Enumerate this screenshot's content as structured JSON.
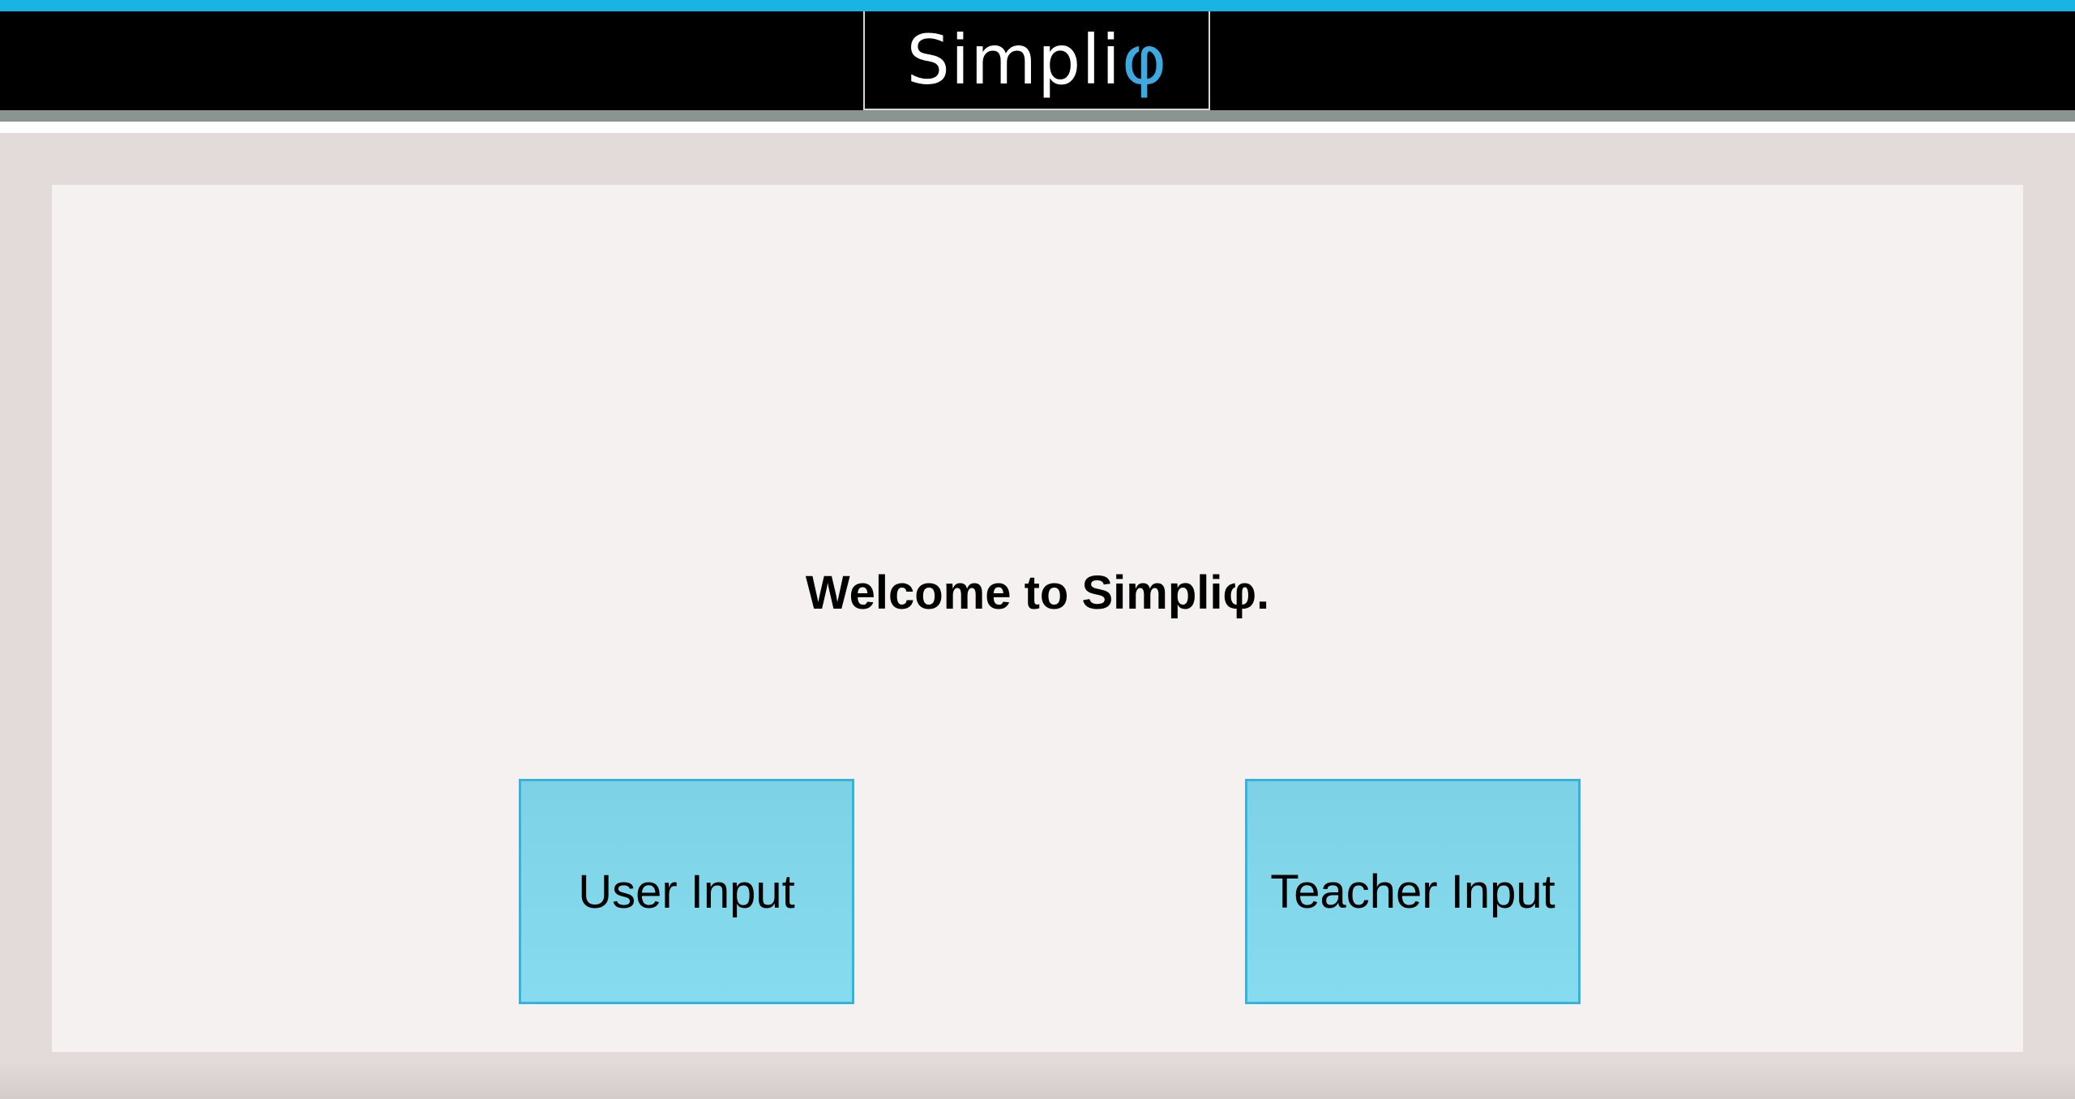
{
  "colors": {
    "accent": "#1ab4e2",
    "header_bg": "#000000",
    "logo_text": "#ffffff",
    "logo_phi": "#3ea9e0",
    "stripe_gray": "#8a9491",
    "page_bg": "#e2dbd9",
    "panel_bg": "#f4f1f0",
    "button_fill": "#84d8ec",
    "button_border": "#35b3dc"
  },
  "header": {
    "logo_text": "Simpli",
    "logo_symbol": "φ"
  },
  "main": {
    "welcome_text": "Welcome to Simpliφ.",
    "buttons": [
      {
        "label": "User Input"
      },
      {
        "label": "Teacher Input"
      }
    ]
  }
}
